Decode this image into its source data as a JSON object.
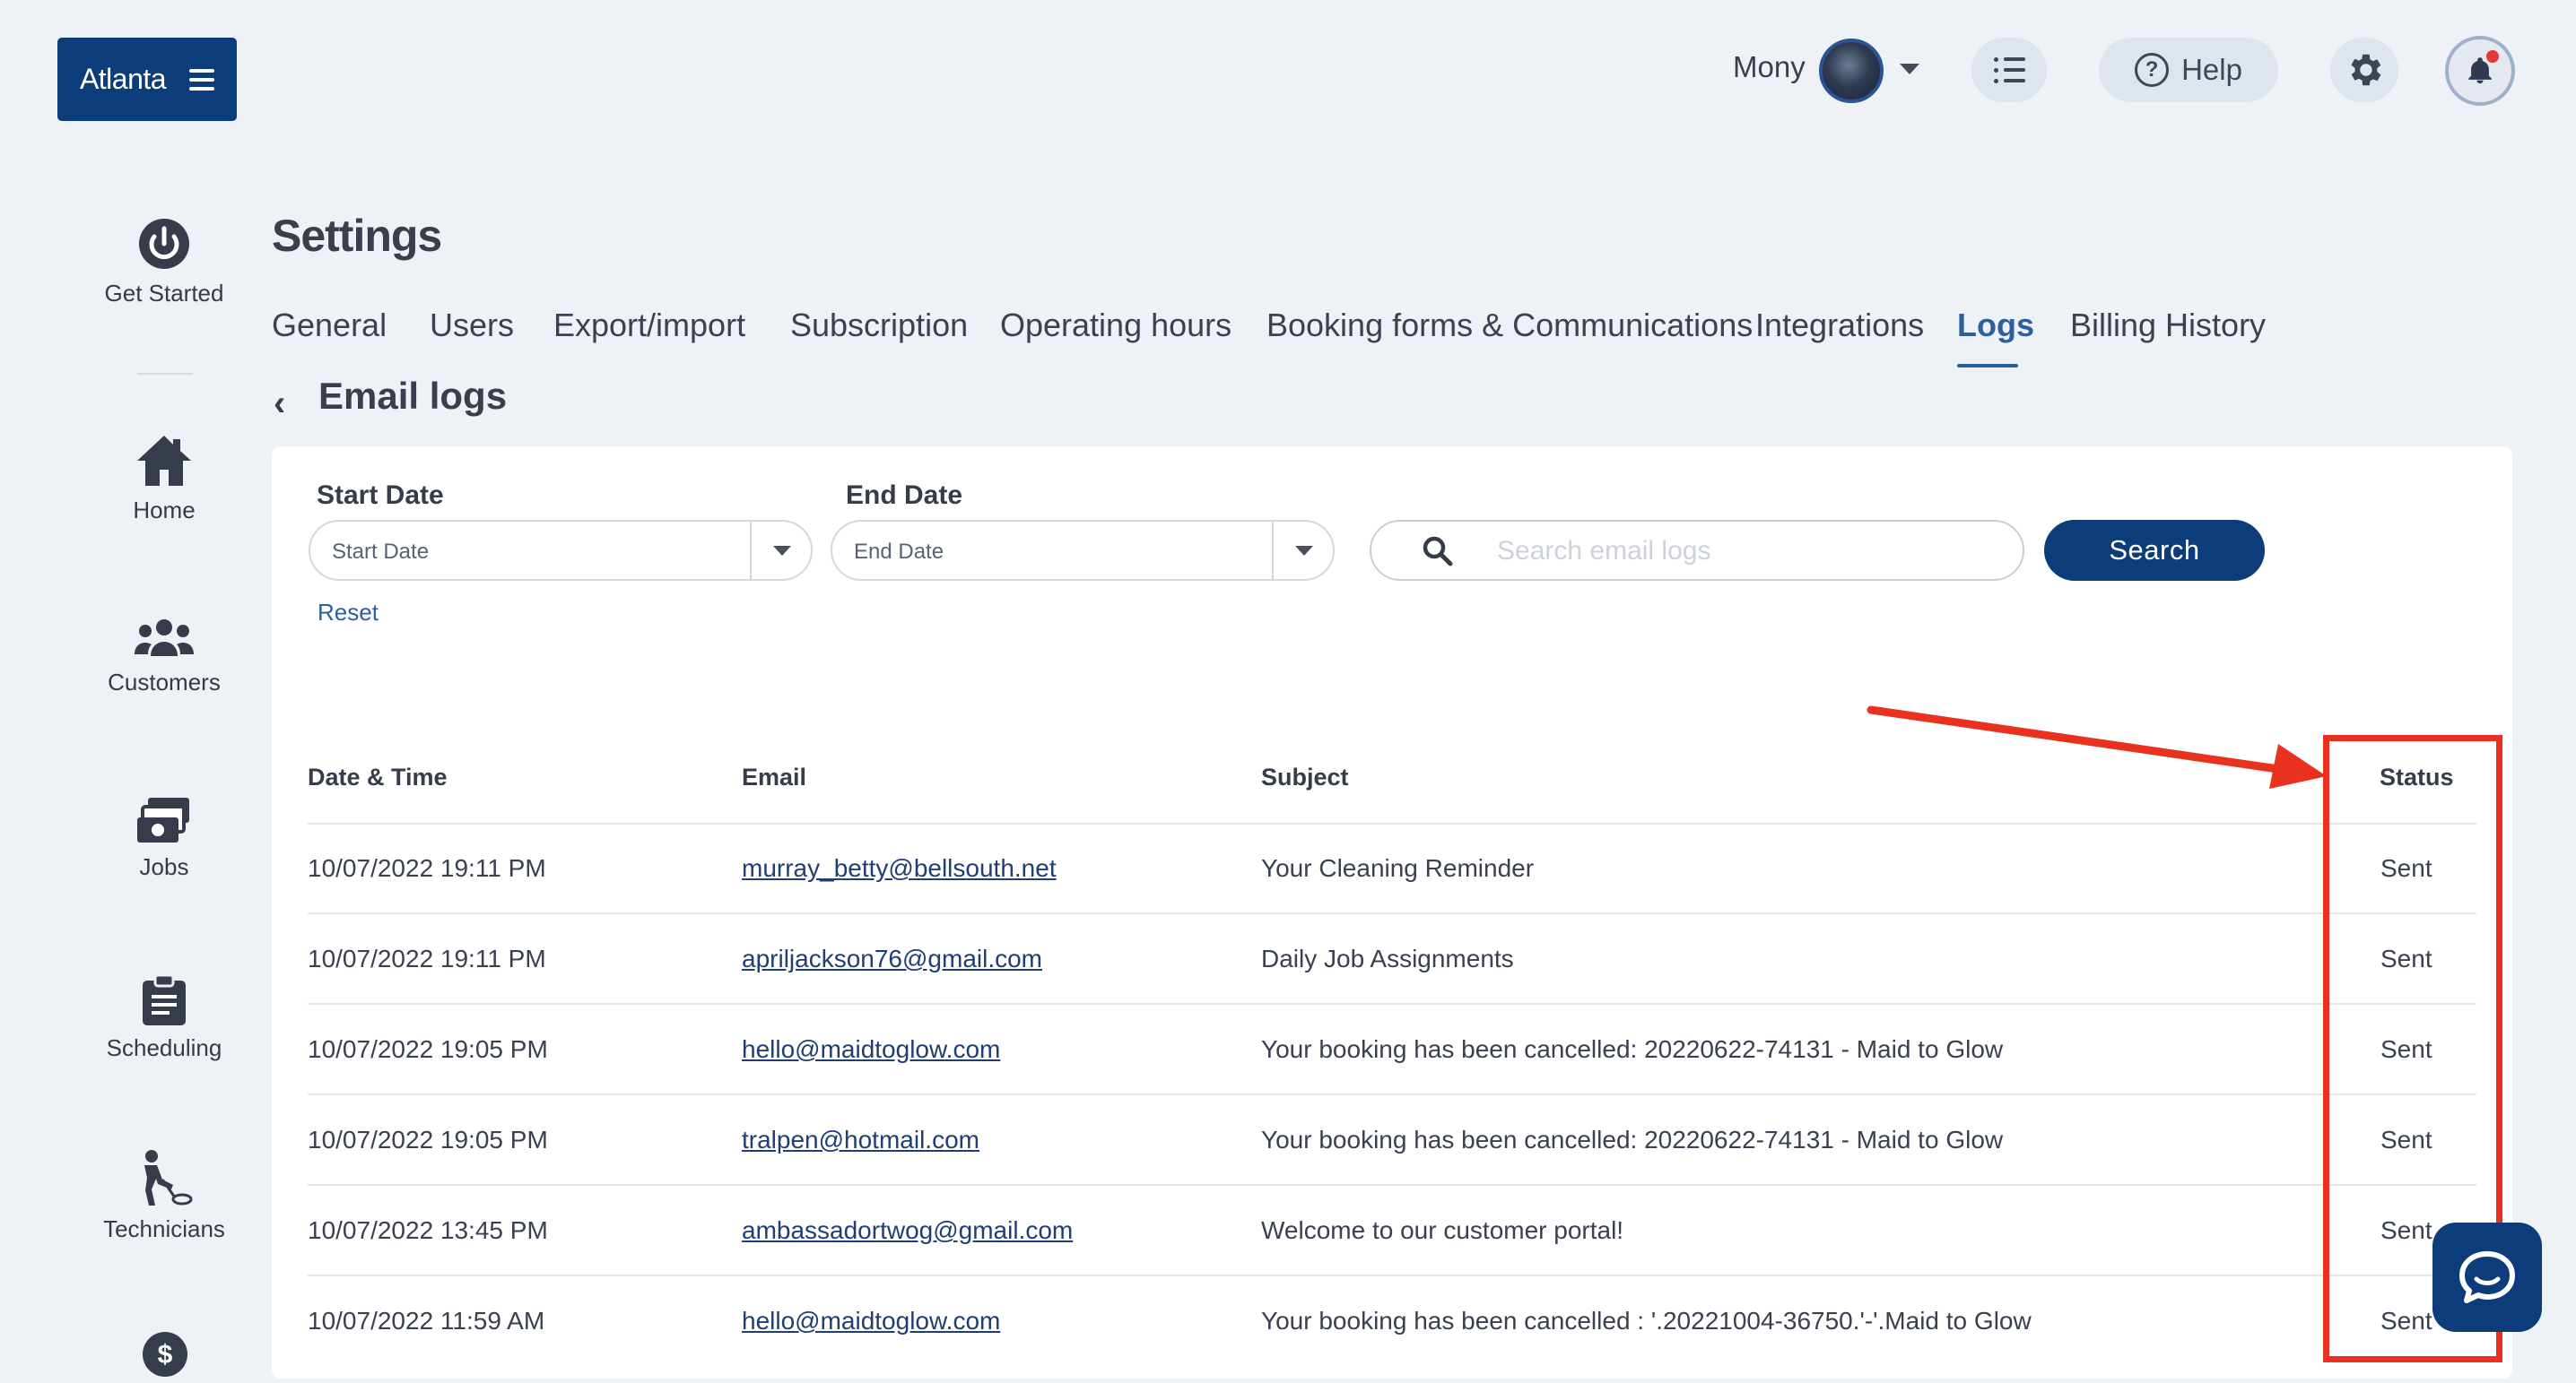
{
  "header": {
    "brand_label": "Atlanta",
    "user_name": "Mony",
    "help_label": "Help"
  },
  "sidebar": {
    "items": [
      {
        "label": "Get Started",
        "icon": "power-icon"
      },
      {
        "label": "Home",
        "icon": "home-icon"
      },
      {
        "label": "Customers",
        "icon": "customers-icon"
      },
      {
        "label": "Jobs",
        "icon": "jobs-icon"
      },
      {
        "label": "Scheduling",
        "icon": "clipboard-icon"
      },
      {
        "label": "Technicians",
        "icon": "technician-icon"
      }
    ]
  },
  "page": {
    "title": "Settings",
    "subtitle": "Email logs",
    "tabs": [
      {
        "label": "General",
        "active": false
      },
      {
        "label": "Users",
        "active": false
      },
      {
        "label": "Export/import",
        "active": false
      },
      {
        "label": "Subscription",
        "active": false
      },
      {
        "label": "Operating hours",
        "active": false
      },
      {
        "label": "Booking forms & Communications",
        "active": false
      },
      {
        "label": "Integrations",
        "active": false
      },
      {
        "label": "Logs",
        "active": true
      },
      {
        "label": "Billing History",
        "active": false
      }
    ]
  },
  "filters": {
    "start_label": "Start Date",
    "start_placeholder": "Start Date",
    "end_label": "End Date",
    "end_placeholder": "End Date",
    "search_placeholder": "Search email logs",
    "search_button": "Search",
    "reset_label": "Reset"
  },
  "table": {
    "headers": [
      "Date & Time",
      "Email",
      "Subject",
      "Status"
    ],
    "rows": [
      {
        "datetime": "10/07/2022 19:11 PM",
        "email": "murray_betty@bellsouth.net",
        "subject": "Your Cleaning Reminder",
        "status": "Sent"
      },
      {
        "datetime": "10/07/2022 19:11 PM",
        "email": "apriljackson76@gmail.com",
        "subject": "Daily Job Assignments",
        "status": "Sent"
      },
      {
        "datetime": "10/07/2022 19:05 PM",
        "email": "hello@maidtoglow.com",
        "subject": "Your booking has been cancelled: 20220622-74131 - Maid to Glow",
        "status": "Sent"
      },
      {
        "datetime": "10/07/2022 19:05 PM",
        "email": "tralpen@hotmail.com",
        "subject": "Your booking has been cancelled: 20220622-74131 - Maid to Glow",
        "status": "Sent"
      },
      {
        "datetime": "10/07/2022 13:45 PM",
        "email": "ambassadortwog@gmail.com",
        "subject": "Welcome to our customer portal!",
        "status": "Sent"
      },
      {
        "datetime": "10/07/2022 11:59 AM",
        "email": "hello@maidtoglow.com",
        "subject": "Your booking has been cancelled : '.20221004-36750.'-'.Maid to Glow",
        "status": "Sent"
      }
    ]
  },
  "colors": {
    "primary": "#0d3c7a",
    "accent": "#2d5f9e",
    "annotation": "#e8321f",
    "background": "#eef2f6"
  }
}
